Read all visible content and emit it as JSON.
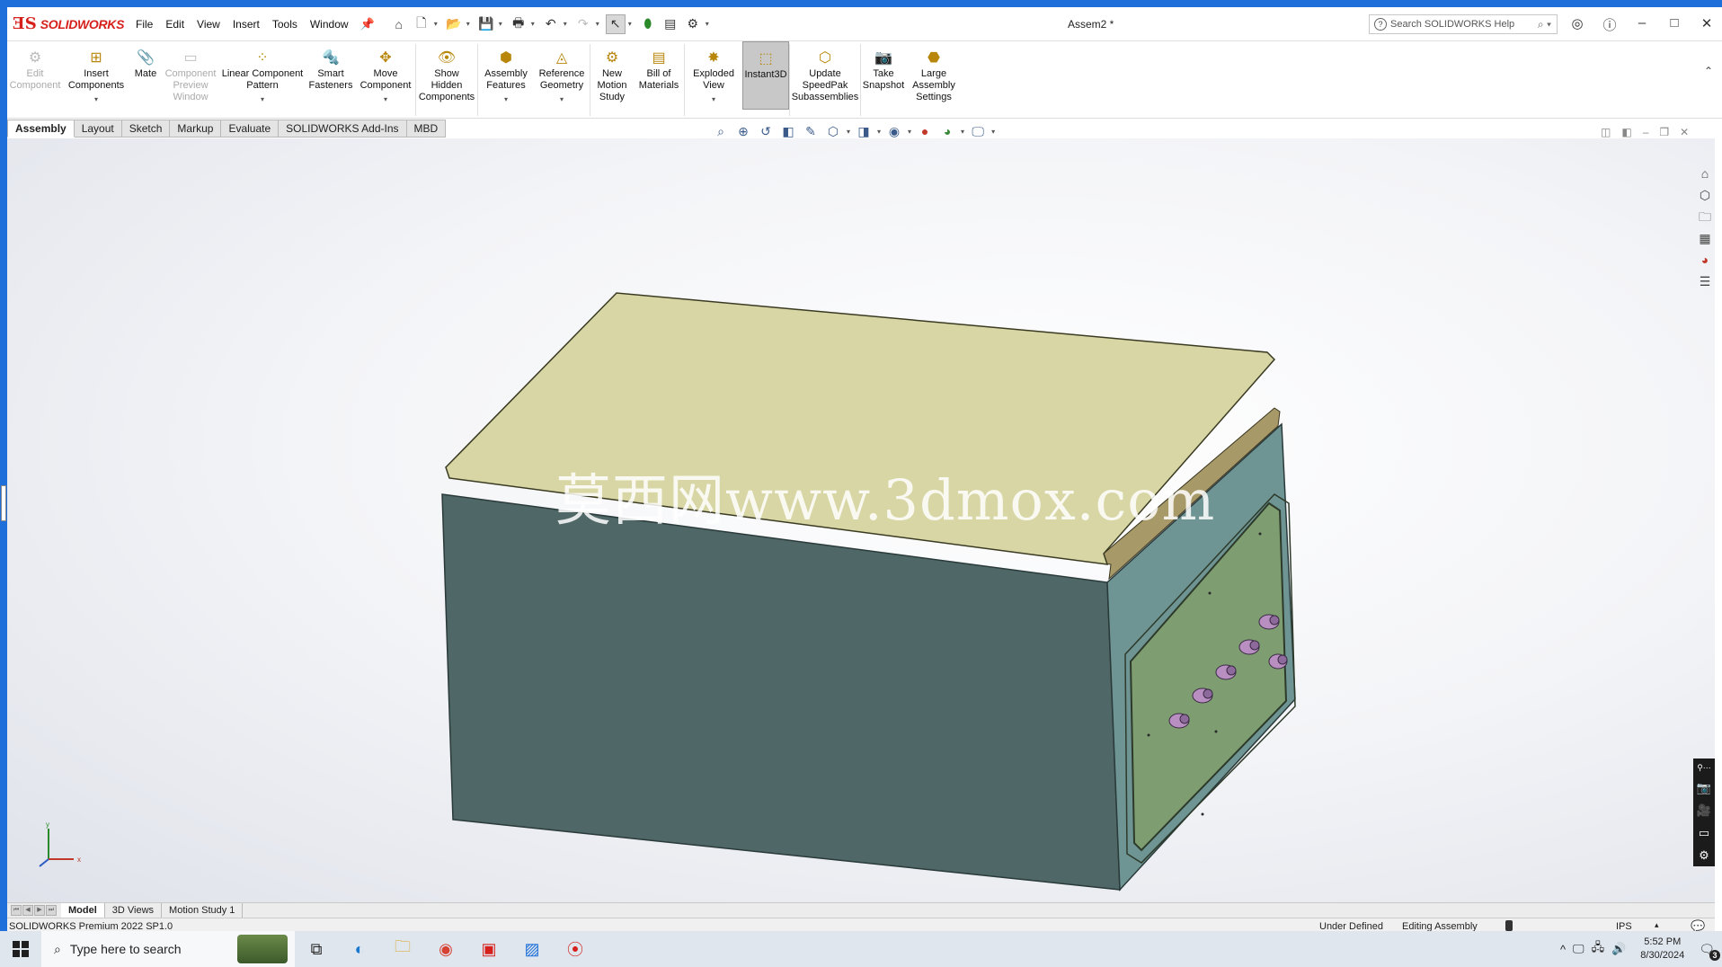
{
  "app": {
    "brand": "SOLIDWORKS",
    "document_title": "Assem2 *",
    "help_search_placeholder": "Search SOLIDWORKS Help"
  },
  "menu": [
    "File",
    "Edit",
    "View",
    "Insert",
    "Tools",
    "Window"
  ],
  "ribbon": [
    {
      "label": "Edit\nComponent",
      "icon": "edit-component-icon",
      "disabled": true
    },
    {
      "label": "Insert\nComponents",
      "icon": "insert-components-icon",
      "dropdown": true
    },
    {
      "label": "Mate",
      "icon": "mate-icon"
    },
    {
      "label": "Component\nPreview\nWindow",
      "icon": "component-preview-icon",
      "disabled": true
    },
    {
      "label": "Linear Component\nPattern",
      "icon": "linear-pattern-icon",
      "dropdown": true
    },
    {
      "label": "Smart\nFasteners",
      "icon": "smart-fasteners-icon"
    },
    {
      "label": "Move\nComponent",
      "icon": "move-component-icon",
      "dropdown": true
    },
    {
      "label": "Show\nHidden\nComponents",
      "icon": "show-hidden-icon"
    },
    {
      "label": "Assembly\nFeatures",
      "icon": "assembly-features-icon",
      "dropdown": true
    },
    {
      "label": "Reference\nGeometry",
      "icon": "reference-geometry-icon",
      "dropdown": true
    },
    {
      "label": "New\nMotion\nStudy",
      "icon": "motion-study-icon"
    },
    {
      "label": "Bill of\nMaterials",
      "icon": "bill-of-materials-icon"
    },
    {
      "label": "Exploded\nView",
      "icon": "exploded-view-icon",
      "dropdown": true
    },
    {
      "label": "Instant3D",
      "icon": "instant3d-icon",
      "active": true
    },
    {
      "label": "Update\nSpeedPak\nSubassemblies",
      "icon": "speedpak-icon"
    },
    {
      "label": "Take\nSnapshot",
      "icon": "snapshot-icon"
    },
    {
      "label": "Large\nAssembly\nSettings",
      "icon": "large-assembly-icon"
    }
  ],
  "tabs": [
    "Assembly",
    "Layout",
    "Sketch",
    "Markup",
    "Evaluate",
    "SOLIDWORKS Add-Ins",
    "MBD"
  ],
  "active_tab": "Assembly",
  "watermark": "莫西网www.3dmox.com",
  "triad": {
    "x": "x",
    "y": "y"
  },
  "model_tabs": [
    "Model",
    "3D Views",
    "Motion Study 1"
  ],
  "active_model_tab": "Model",
  "status": {
    "product": "SOLIDWORKS Premium 2022 SP1.0",
    "definition": "Under Defined",
    "mode": "Editing Assembly",
    "units": "IPS"
  },
  "taskbar": {
    "search_placeholder": "Type here to search",
    "time": "5:52 PM",
    "date": "8/30/2024",
    "notification_count": "3"
  },
  "colors": {
    "brand_red": "#d6201c",
    "box_front": "#4f6766",
    "box_side": "#6e9593",
    "lid_top": "#d7d6a4",
    "panel_green": "#7e9d71",
    "connector": "#b88fc0"
  }
}
